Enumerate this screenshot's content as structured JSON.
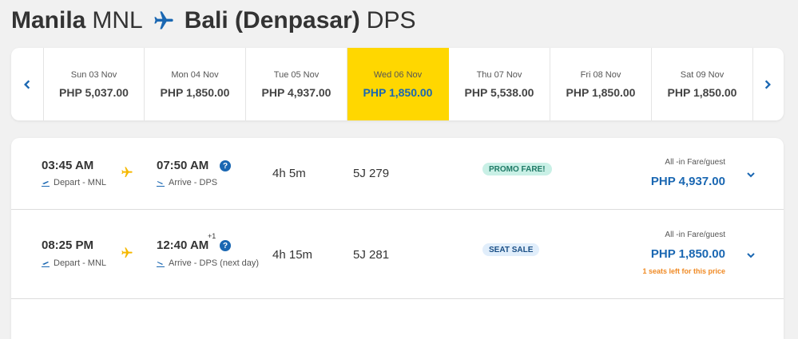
{
  "route": {
    "origin_city": "Manila",
    "origin_code": "MNL",
    "dest_city": "Bali (Denpasar)",
    "dest_code": "DPS",
    "plane_icon": "airplane-icon"
  },
  "date_strip": {
    "prev_icon": "chevron-left-icon",
    "next_icon": "chevron-right-icon",
    "selected_index": 3,
    "dates": [
      {
        "date": "Sun 03 Nov",
        "price": "PHP 5,037.00"
      },
      {
        "date": "Mon 04 Nov",
        "price": "PHP 1,850.00"
      },
      {
        "date": "Tue 05 Nov",
        "price": "PHP 4,937.00"
      },
      {
        "date": "Wed 06 Nov",
        "price": "PHP 1,850.00"
      },
      {
        "date": "Thu 07 Nov",
        "price": "PHP 5,538.00"
      },
      {
        "date": "Fri 08 Nov",
        "price": "PHP 1,850.00"
      },
      {
        "date": "Sat 09 Nov",
        "price": "PHP 1,850.00"
      }
    ]
  },
  "flights": [
    {
      "depart_time": "03:45 AM",
      "depart_label": "Depart - MNL",
      "arrive_time": "07:50 AM",
      "arrive_label": "Arrive - DPS",
      "day_offset": "",
      "duration": "4h 5m",
      "flight_number": "5J 279",
      "badge": "PROMO FARE!",
      "fare_label": "All -in Fare/guest",
      "fare": "PHP 4,937.00",
      "seats_left": ""
    },
    {
      "depart_time": "08:25 PM",
      "depart_label": "Depart - MNL",
      "arrive_time": "12:40 AM",
      "arrive_label": "Arrive - DPS (next day)",
      "day_offset": "+1",
      "duration": "4h 15m",
      "flight_number": "5J 281",
      "badge": "SEAT SALE",
      "fare_label": "All -in Fare/guest",
      "fare": "PHP 1,850.00",
      "seats_left": "1 seats left for this price"
    }
  ],
  "colors": {
    "brand_blue": "#1a67b2",
    "selected_yellow": "#ffd700",
    "accent_orange": "#f08a24",
    "plane_yellow": "#f5b800"
  }
}
